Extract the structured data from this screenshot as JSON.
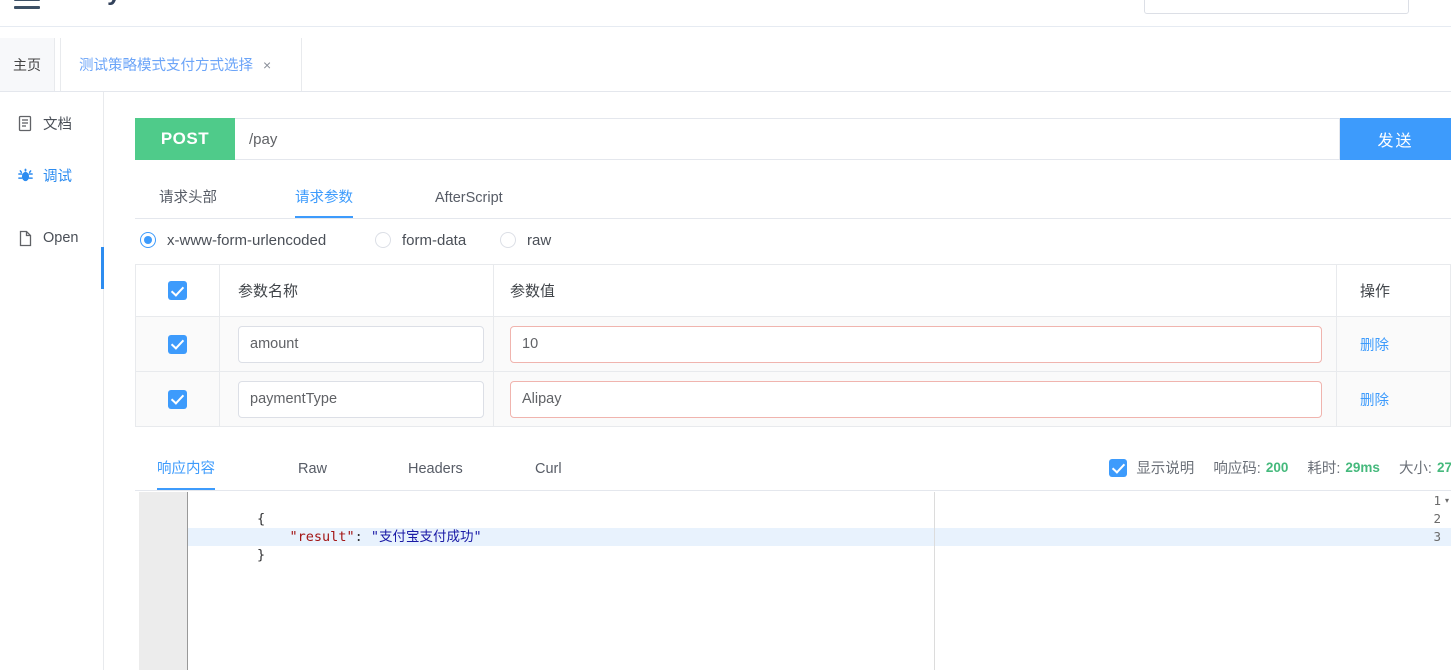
{
  "topbar": {
    "menu_icon": "hamburger-icon",
    "app_title": "daily-test",
    "search_text": "",
    "avatar_icon": "avatar-icon"
  },
  "tabstrip": {
    "home_tab": "主页",
    "doc_tab": "测试策略模式支付方式选择",
    "close_icon": "×"
  },
  "rail": {
    "items": [
      {
        "label": "文档",
        "icon": "document-icon",
        "active": false
      },
      {
        "label": "调试",
        "icon": "bug-icon",
        "active": true
      },
      {
        "label": "Open",
        "icon": "file-icon",
        "active": false
      }
    ]
  },
  "request": {
    "method": "POST",
    "url_value": "/pay",
    "url_placeholder": "",
    "send_label": "发送",
    "tabs": [
      {
        "label": "请求头部",
        "active": false
      },
      {
        "label": "请求参数",
        "active": true
      },
      {
        "label": "AfterScript",
        "active": false
      }
    ],
    "body_types": [
      {
        "label": "x-www-form-urlencoded",
        "selected": true
      },
      {
        "label": "form-data",
        "selected": false
      },
      {
        "label": "raw",
        "selected": false
      }
    ],
    "table": {
      "headers": {
        "select_all": true,
        "name": "参数名称",
        "value": "参数值",
        "action": "操作"
      },
      "rows": [
        {
          "checked": true,
          "name": "amount",
          "value": "10",
          "action_label": "删除"
        },
        {
          "checked": true,
          "name": "paymentType",
          "value": "Alipay",
          "action_label": "删除"
        }
      ]
    }
  },
  "response": {
    "tabs": [
      {
        "label": "响应内容",
        "active": true
      },
      {
        "label": "Raw",
        "active": false
      },
      {
        "label": "Headers",
        "active": false
      },
      {
        "label": "Curl",
        "active": false
      }
    ],
    "show_desc_checked": true,
    "show_desc_label": "显示说明",
    "status_key": "响应码:",
    "status_value": "200",
    "time_key": "耗时:",
    "time_value": "29ms",
    "size_key": "大小:",
    "size_value": "27",
    "editor": {
      "lines": [
        {
          "num": "1",
          "fold": true,
          "tokens": [
            {
              "t": "{",
              "c": "pun"
            }
          ]
        },
        {
          "num": "2",
          "fold": false,
          "tokens": [
            {
              "t": "    ",
              "c": "pun"
            },
            {
              "t": "\"result\"",
              "c": "key"
            },
            {
              "t": ": ",
              "c": "pun"
            },
            {
              "t": "\"支付宝支付成功\"",
              "c": "str"
            }
          ]
        },
        {
          "num": "3",
          "fold": false,
          "highlight": true,
          "tokens": [
            {
              "t": "}",
              "c": "pun"
            }
          ]
        }
      ]
    }
  },
  "colors": {
    "accent_blue": "#3d9bfc",
    "method_green": "#4fcb8a",
    "status_green": "#45b97c",
    "warn_border": "#f0b4ae",
    "highlight_row": "#e8f2fd"
  }
}
